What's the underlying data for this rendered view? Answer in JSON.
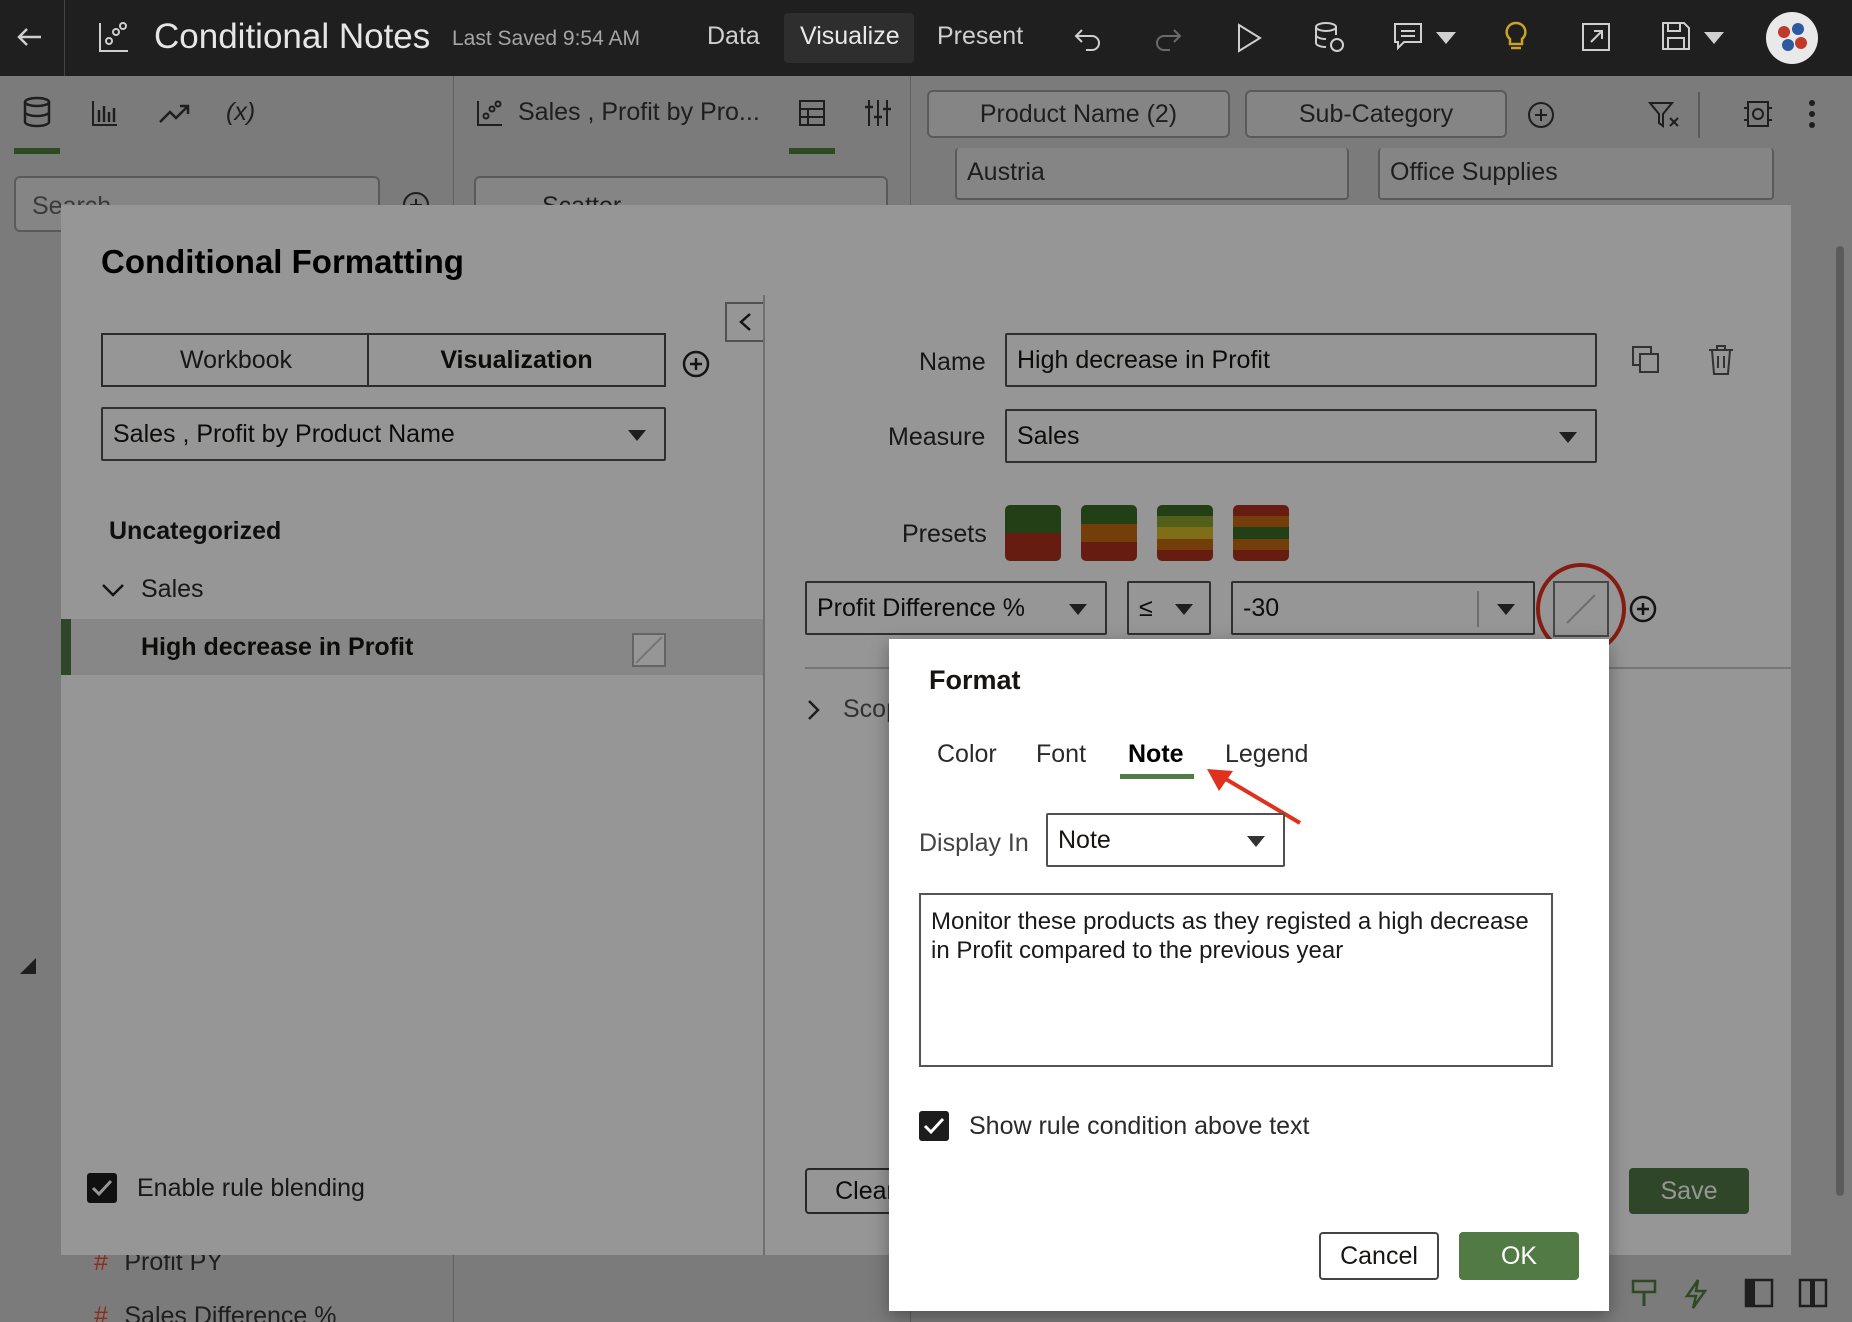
{
  "topbar": {
    "app_title": "Conditional Notes",
    "last_saved": "Last Saved 9:54 AM",
    "tabs": [
      "Data",
      "Visualize",
      "Present"
    ],
    "active_tab": "Visualize"
  },
  "side_panel": {
    "search_placeholder": "Search",
    "items": [
      {
        "glyph": "#",
        "label": "Profit PY"
      },
      {
        "glyph": "#",
        "label": "Sales Difference %"
      }
    ]
  },
  "mid_panel": {
    "viz_title": "Sales , Profit by Pro...",
    "viz_type": "Scatter"
  },
  "canvas": {
    "drop_targets": [
      "Product Name (2)",
      "Sub-Category"
    ],
    "filters": [
      "Austria",
      "Office Supplies"
    ]
  },
  "cf_dialog": {
    "title": "Conditional Formatting",
    "scope_tabs": [
      "Workbook",
      "Visualization"
    ],
    "active_scope": "Visualization",
    "visualization_select": "Sales , Profit by Product Name",
    "group_heading": "Uncategorized",
    "group_name": "Sales",
    "rule_name": "High decrease in Profit",
    "enable_blending_label": "Enable rule blending",
    "enable_blending_checked": true,
    "form": {
      "name_label": "Name",
      "name_value": "High decrease in Profit",
      "measure_label": "Measure",
      "measure_value": "Sales",
      "presets_label": "Presets",
      "condition_measure": "Profit Difference %",
      "operator": "≤",
      "threshold": "-30",
      "scope_label": "Scop"
    },
    "clear_button": "Clear",
    "save_button": "Save"
  },
  "format_popup": {
    "title": "Format",
    "tabs": [
      "Color",
      "Font",
      "Note",
      "Legend"
    ],
    "active_tab": "Note",
    "display_in_label": "Display In",
    "display_in_value": "Note",
    "note_text": "Monitor these products as they registed a high decrease in Profit compared to the previous year",
    "show_condition_label": "Show rule condition above text",
    "show_condition_checked": true,
    "cancel_button": "Cancel",
    "ok_button": "OK"
  },
  "colors": {
    "accent_green": "#517a44",
    "annotation_red": "#e0301e",
    "preset_1": [
      "#3b6b24",
      "#b0301f"
    ],
    "preset_2": [
      "#3b6b24",
      "#c46a10",
      "#b0301f"
    ],
    "preset_3": [
      "#3b6b24",
      "#8aa22e",
      "#d8b92a",
      "#c46a10",
      "#b0301f"
    ],
    "preset_4": [
      "#b0301f",
      "#c46a10",
      "#3b6b24",
      "#c46a10",
      "#b0301f"
    ]
  }
}
